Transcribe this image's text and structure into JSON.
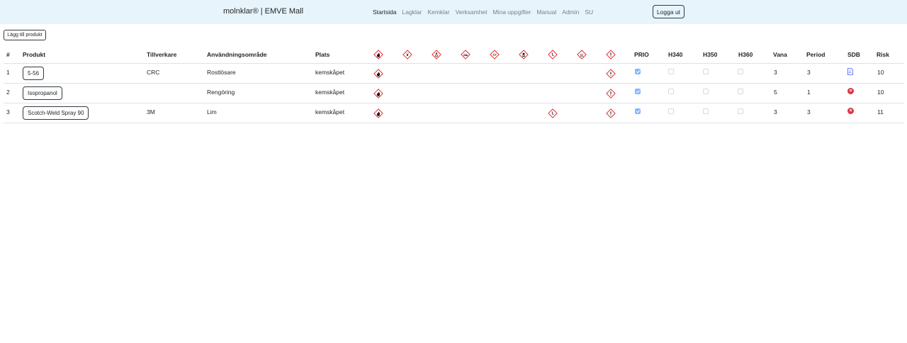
{
  "brand": "molnklar® | EMVE Mall",
  "nav": {
    "items": [
      "Startsida",
      "Lagklar",
      "Kemklar",
      "Verksamhet",
      "Mina uppgifter",
      "Manual",
      "Admin",
      "SU"
    ],
    "active": "Startsida",
    "logout": "Logga ut"
  },
  "add_product": "Lägg till produkt",
  "colors": {
    "navbar_bg": "#e7f4fb",
    "ghs_red": "#e8262b",
    "check_on": "#86b7fe",
    "error_red": "#dc3545",
    "pdf_blue": "#3d5afe"
  },
  "table": {
    "headers": {
      "num": "#",
      "product": "Produkt",
      "manufacturer": "Tillverkare",
      "usage": "Användningsområde",
      "location": "Plats",
      "prio": "PRIO",
      "h340": "H340",
      "h350": "H350",
      "h360": "H360",
      "habit": "Vana",
      "period": "Period",
      "sdb": "SDB",
      "risk": "Risk"
    },
    "ghs_icons": [
      "flame-icon",
      "exploding-bomb-icon",
      "flame-over-circle-icon",
      "corrosion-icon",
      "gas-cylinder-icon",
      "skull-crossbones-icon",
      "health-hazard-icon",
      "environment-icon",
      "exclamation-icon"
    ],
    "rows": [
      {
        "num": "1",
        "product": "5-56",
        "manufacturer": "CRC",
        "usage": "Rostlösare",
        "location": "kemskåpet",
        "ghs": [
          true,
          false,
          false,
          false,
          false,
          false,
          false,
          false,
          true
        ],
        "prio": true,
        "h340": false,
        "h350": false,
        "h360": false,
        "habit": "3",
        "period": "3",
        "sdb": "pdf-icon",
        "risk": "10"
      },
      {
        "num": "2",
        "product": "Isopropanol",
        "manufacturer": "",
        "usage": "Rengöring",
        "location": "kemskåpet",
        "ghs": [
          true,
          false,
          false,
          false,
          false,
          false,
          false,
          false,
          true
        ],
        "prio": true,
        "h340": false,
        "h350": false,
        "h360": false,
        "habit": "5",
        "period": "1",
        "sdb": "missing-icon",
        "risk": "10"
      },
      {
        "num": "3",
        "product": "Scotch-Weld Spray 90",
        "manufacturer": "3M",
        "usage": "Lim",
        "location": "kemskåpet",
        "ghs": [
          true,
          false,
          false,
          false,
          false,
          false,
          true,
          false,
          true
        ],
        "prio": true,
        "h340": false,
        "h350": false,
        "h360": false,
        "habit": "3",
        "period": "3",
        "sdb": "missing-icon",
        "risk": "11"
      }
    ]
  }
}
